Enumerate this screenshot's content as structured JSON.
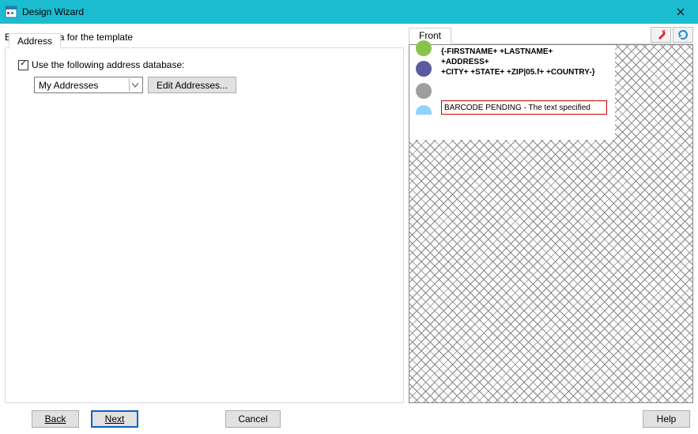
{
  "window": {
    "title": "Design Wizard"
  },
  "instruction": "Enter the data for the template",
  "left": {
    "tab_label": "Address",
    "checkbox_label": "Use the following address database:",
    "combo_value": "My Addresses",
    "edit_button": "Edit Addresses..."
  },
  "right": {
    "tab_label": "Front"
  },
  "preview": {
    "addr_line1": "{-FIRSTNAME+ +LASTNAME+",
    "addr_line2": "+ADDRESS+",
    "addr_line3": "+CITY+ +STATE+ +ZIP|05.f+ +COUNTRY-}",
    "barcode_text": "BARCODE PENDING - The text specified"
  },
  "buttons": {
    "back": "Back",
    "next": "Next",
    "cancel": "Cancel",
    "help": "Help"
  }
}
